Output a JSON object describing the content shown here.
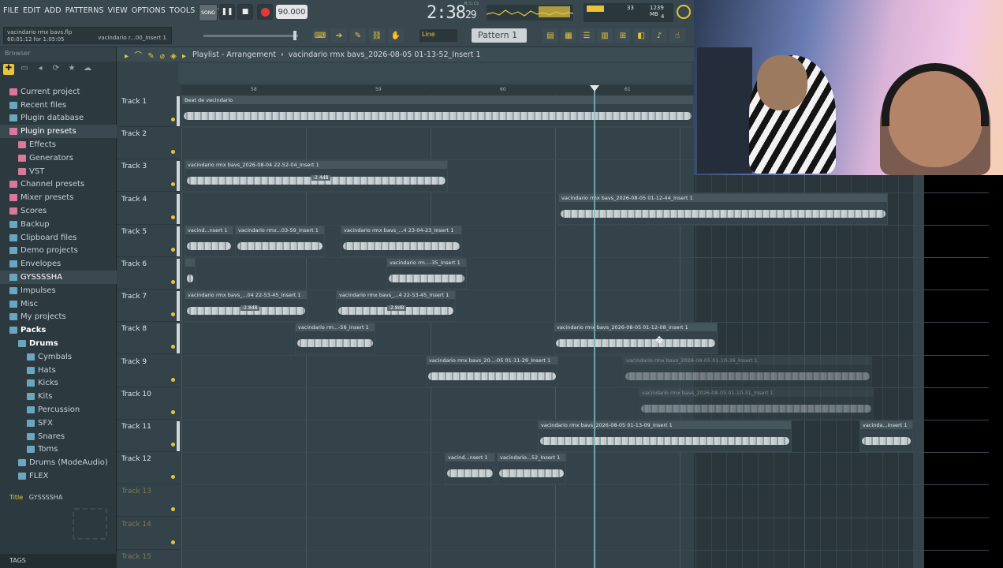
{
  "menu": [
    "FILE",
    "EDIT",
    "ADD",
    "PATTERNS",
    "VIEW",
    "OPTIONS",
    "TOOLS",
    "HELP"
  ],
  "song_info": {
    "file": "vacindario rmx bavs.flp",
    "time": "60:01:12 for 1:05:05",
    "insert": "vacindario r...00_Insert 1"
  },
  "transport": {
    "song_label": "SONG",
    "tempo": "90.000"
  },
  "clock": {
    "main": "2:38",
    "sub": "29",
    "label": "M:S:CS"
  },
  "cpu": {
    "voices": "33",
    "ram": "1239 MB",
    "poly": "4"
  },
  "snap": {
    "mode": "Line"
  },
  "pattern": {
    "name": "Pattern 1"
  },
  "browser": {
    "title": "Browser",
    "items": [
      {
        "label": "Current project",
        "type": "pink",
        "indent": 0
      },
      {
        "label": "Recent files",
        "type": "folder",
        "indent": 0
      },
      {
        "label": "Plugin database",
        "type": "folder",
        "indent": 0
      },
      {
        "label": "Plugin presets",
        "type": "pink",
        "indent": 0,
        "hi": true
      },
      {
        "label": "Effects",
        "type": "pink",
        "indent": 1
      },
      {
        "label": "Generators",
        "type": "pink",
        "indent": 1
      },
      {
        "label": "VST",
        "type": "pink",
        "indent": 1
      },
      {
        "label": "Channel presets",
        "type": "pink",
        "indent": 0
      },
      {
        "label": "Mixer presets",
        "type": "pink",
        "indent": 0
      },
      {
        "label": "Scores",
        "type": "pink",
        "indent": 0
      },
      {
        "label": "Backup",
        "type": "folder",
        "indent": 0
      },
      {
        "label": "Clipboard files",
        "type": "folder",
        "indent": 0
      },
      {
        "label": "Demo projects",
        "type": "folder",
        "indent": 0
      },
      {
        "label": "Envelopes",
        "type": "folder",
        "indent": 0
      },
      {
        "label": "GYSSSSHA",
        "type": "folder",
        "indent": 0,
        "hi": true
      },
      {
        "label": "Impulses",
        "type": "folder",
        "indent": 0
      },
      {
        "label": "Misc",
        "type": "folder",
        "indent": 0
      },
      {
        "label": "My projects",
        "type": "folder",
        "indent": 0
      },
      {
        "label": "Packs",
        "type": "folder",
        "indent": 0,
        "bold": true
      },
      {
        "label": "Drums",
        "type": "folder",
        "indent": 1,
        "bold": true
      },
      {
        "label": "Cymbals",
        "type": "folder",
        "indent": 2
      },
      {
        "label": "Hats",
        "type": "folder",
        "indent": 2
      },
      {
        "label": "Kicks",
        "type": "folder",
        "indent": 2
      },
      {
        "label": "Kits",
        "type": "folder",
        "indent": 2
      },
      {
        "label": "Percussion",
        "type": "folder",
        "indent": 2
      },
      {
        "label": "SFX",
        "type": "folder",
        "indent": 2
      },
      {
        "label": "Snares",
        "type": "folder",
        "indent": 2
      },
      {
        "label": "Toms",
        "type": "folder",
        "indent": 2
      },
      {
        "label": "Drums (ModeAudio)",
        "type": "folder",
        "indent": 1
      },
      {
        "label": "FLEX",
        "type": "folder",
        "indent": 1
      }
    ],
    "title_label": "Title",
    "title_value": "GYSSSSHA",
    "tags_label": "TAGS"
  },
  "playlist": {
    "title": "Playlist - Arrangement",
    "path": "vacindario rmx bavs_2026-08-05 01-13-52_Insert 1",
    "ruler": [
      "58",
      "59",
      "60",
      "61"
    ],
    "tracks": [
      "Track 1",
      "Track 2",
      "Track 3",
      "Track 4",
      "Track 5",
      "Track 6",
      "Track 7",
      "Track 8",
      "Track 9",
      "Track 10",
      "Track 11",
      "Track 12",
      "Track 13",
      "Track 14",
      "Track 15"
    ],
    "clips": [
      {
        "track": 0,
        "start": 0,
        "end": 650,
        "label": "Beat de vecindario"
      },
      {
        "track": 2,
        "start": 4,
        "end": 338,
        "label": "vacindario rmx bavs_2026-08-04 22-52-04_Insert 1",
        "gain": "-2.4dB",
        "gainAt": 160
      },
      {
        "track": 3,
        "start": 478,
        "end": 896,
        "label": "vacindario rmx bavs_2026-08-05 01-12-44_Insert 1"
      },
      {
        "track": 4,
        "start": 4,
        "end": 66,
        "label": "vacind...nsert 1"
      },
      {
        "track": 4,
        "start": 68,
        "end": 182,
        "label": "vacindario rmx...03-59_Insert 1"
      },
      {
        "track": 4,
        "start": 202,
        "end": 356,
        "label": "vacindario rmx bavs_...4 23-04-23_Insert 1"
      },
      {
        "track": 5,
        "start": 4,
        "end": 18,
        "label": ""
      },
      {
        "track": 5,
        "start": 260,
        "end": 362,
        "label": "vacindario rm...-35_Insert 1"
      },
      {
        "track": 6,
        "start": 4,
        "end": 160,
        "label": "vacindario rmx bavs_...04 22-53-45_Insert 1",
        "gain": "-2.8dB",
        "gainAt": 70
      },
      {
        "track": 6,
        "start": 196,
        "end": 348,
        "label": "vacindario rmx bavs_...4 22-53-45_Insert 1",
        "gain": "-2.8dB",
        "gainAt": 64
      },
      {
        "track": 7,
        "start": 144,
        "end": 246,
        "label": "vacindario rm...-56_Insert 1"
      },
      {
        "track": 7,
        "start": 472,
        "end": 680,
        "label": "vacindario rmx bavs_2026-08-05 01-12-08_Insert 1"
      },
      {
        "track": 8,
        "start": 310,
        "end": 478,
        "label": "vacindario rmx bavs_20...-05 01-11-29_Insert 1"
      },
      {
        "track": 8,
        "start": 560,
        "end": 876,
        "label": "vacindario rmx bavs_2026-08-05 01-10-36_Insert 1",
        "muted": true
      },
      {
        "track": 9,
        "start": 580,
        "end": 878,
        "label": "vacindario rmx bavs_2026-08-05 01-10-31_Insert 1",
        "muted": true
      },
      {
        "track": 10,
        "start": 452,
        "end": 774,
        "label": "vacindario rmx bavs_2026-08-05 01-13-09_Insert 1"
      },
      {
        "track": 10,
        "start": 860,
        "end": 928,
        "label": "vacinda...Insert 1"
      },
      {
        "track": 11,
        "start": 334,
        "end": 398,
        "label": "vacind...nsert 1"
      },
      {
        "track": 11,
        "start": 400,
        "end": 488,
        "label": "vacindario...52_Insert 1"
      }
    ]
  },
  "colors": {
    "accent": "#e8c53a",
    "record": "#e23a3a",
    "playhead": "#7fbabc"
  }
}
